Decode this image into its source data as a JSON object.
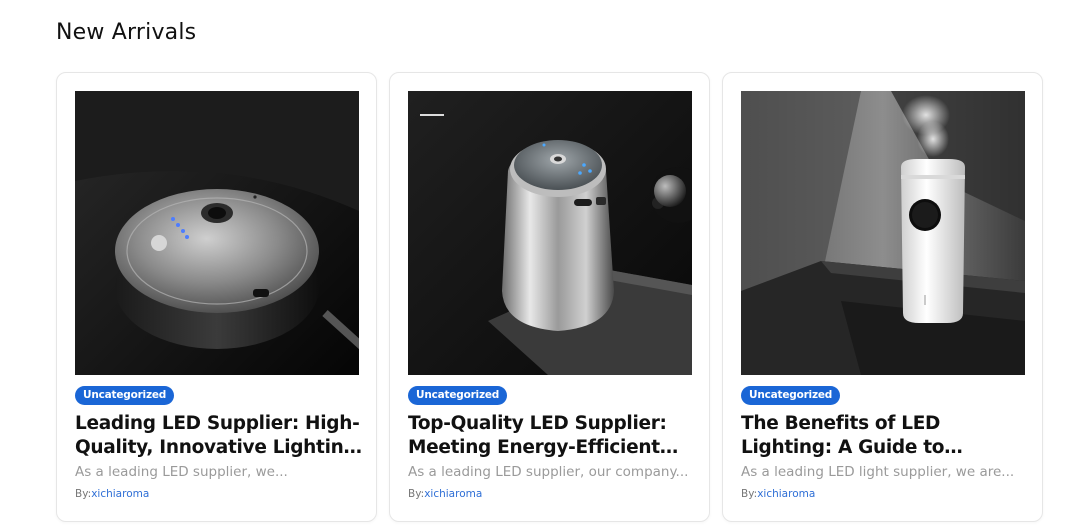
{
  "section": {
    "title": "New Arrivals"
  },
  "posts": [
    {
      "category": "Uncategorized",
      "title": "Leading LED Supplier: High-Quality, Innovative Lighting Solutions",
      "excerpt": "As a leading LED supplier, we...",
      "by_label": "By:",
      "author": "xichiaroma",
      "image": "led-diffuser-round-black"
    },
    {
      "category": "Uncategorized",
      "title": "Top-Quality LED Supplier: Meeting Energy-Efficient Lighting Needs",
      "excerpt": "As a leading LED supplier, our company...",
      "by_label": "By:",
      "author": "xichiaroma",
      "image": "silver-cylinder-diffuser"
    },
    {
      "category": "Uncategorized",
      "title": "The Benefits of LED Lighting: A Guide to Connecting LED Lights",
      "excerpt": "As a leading LED light supplier, we are...",
      "by_label": "By:",
      "author": "xichiaroma",
      "image": "white-humidifier"
    }
  ],
  "colors": {
    "badge": "#1a66d6",
    "author_link": "#2f6fd6",
    "excerpt": "#9a9a9a"
  }
}
